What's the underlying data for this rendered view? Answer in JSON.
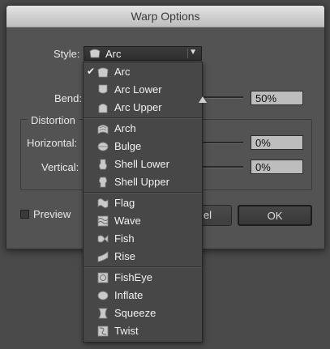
{
  "dialog": {
    "title": "Warp Options",
    "style_label": "Style:",
    "style_value": "Arc",
    "bend_label": "Bend:",
    "bend_value": "50%",
    "bend_level": 0.5,
    "distortion_label": "Distortion",
    "horizontal_label": "Horizontal:",
    "horizontal_value": "0%",
    "vertical_label": "Vertical:",
    "vertical_value": "0%",
    "preview_label": "Preview",
    "preview_checked": false,
    "cancel_label": "el",
    "ok_label": "OK"
  },
  "menu": {
    "groups": [
      [
        {
          "label": "Arc",
          "icon": "arc-icon",
          "checked": true
        },
        {
          "label": "Arc Lower",
          "icon": "arc-lower-icon"
        },
        {
          "label": "Arc Upper",
          "icon": "arc-upper-icon"
        }
      ],
      [
        {
          "label": "Arch",
          "icon": "arch-icon"
        },
        {
          "label": "Bulge",
          "icon": "bulge-icon"
        },
        {
          "label": "Shell Lower",
          "icon": "shell-lower-icon"
        },
        {
          "label": "Shell Upper",
          "icon": "shell-upper-icon"
        }
      ],
      [
        {
          "label": "Flag",
          "icon": "flag-icon"
        },
        {
          "label": "Wave",
          "icon": "wave-icon"
        },
        {
          "label": "Fish",
          "icon": "fish-icon"
        },
        {
          "label": "Rise",
          "icon": "rise-icon"
        }
      ],
      [
        {
          "label": "FishEye",
          "icon": "fisheye-icon"
        },
        {
          "label": "Inflate",
          "icon": "inflate-icon"
        },
        {
          "label": "Squeeze",
          "icon": "squeeze-icon"
        },
        {
          "label": "Twist",
          "icon": "twist-icon"
        }
      ]
    ]
  },
  "colors": {
    "dialog_bg": "#535353",
    "menu_bg": "#474747",
    "field_bg": "#bdbdbd"
  }
}
